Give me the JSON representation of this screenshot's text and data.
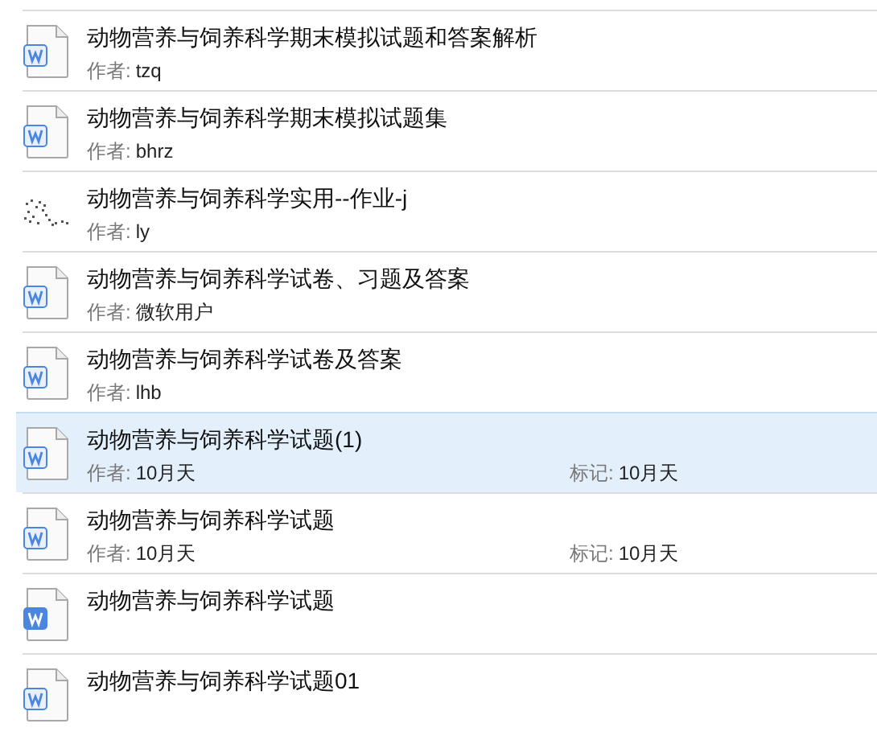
{
  "files": [
    {
      "kind": "doc",
      "title": "动物营养与饲养科学期末模拟试题和答案解析",
      "author_label": "作者:",
      "author": "tzq",
      "selected": false
    },
    {
      "kind": "doc",
      "title": "动物营养与饲养科学期末模拟试题集",
      "author_label": "作者:",
      "author": "bhrz",
      "selected": false
    },
    {
      "kind": "unknown",
      "title": "动物营养与饲养科学实用--作业-j",
      "author_label": "作者:",
      "author": "ly",
      "selected": false
    },
    {
      "kind": "doc",
      "title": "动物营养与饲养科学试卷、习题及答案",
      "author_label": "作者:",
      "author": "微软用户",
      "selected": false
    },
    {
      "kind": "doc",
      "title": "动物营养与饲养科学试卷及答案",
      "author_label": "作者:",
      "author": "lhb",
      "selected": false
    },
    {
      "kind": "doc",
      "title": "动物营养与饲养科学试题(1)",
      "author_label": "作者:",
      "author": "10月天",
      "tag_label": "标记:",
      "tag": "10月天",
      "selected": true
    },
    {
      "kind": "doc",
      "title": "动物营养与饲养科学试题",
      "author_label": "作者:",
      "author": "10月天",
      "tag_label": "标记:",
      "tag": "10月天",
      "selected": false
    },
    {
      "kind": "doc-filled",
      "title": "动物营养与饲养科学试题",
      "selected": false
    },
    {
      "kind": "doc",
      "title": "动物营养与饲养科学试题01",
      "selected": false
    }
  ]
}
